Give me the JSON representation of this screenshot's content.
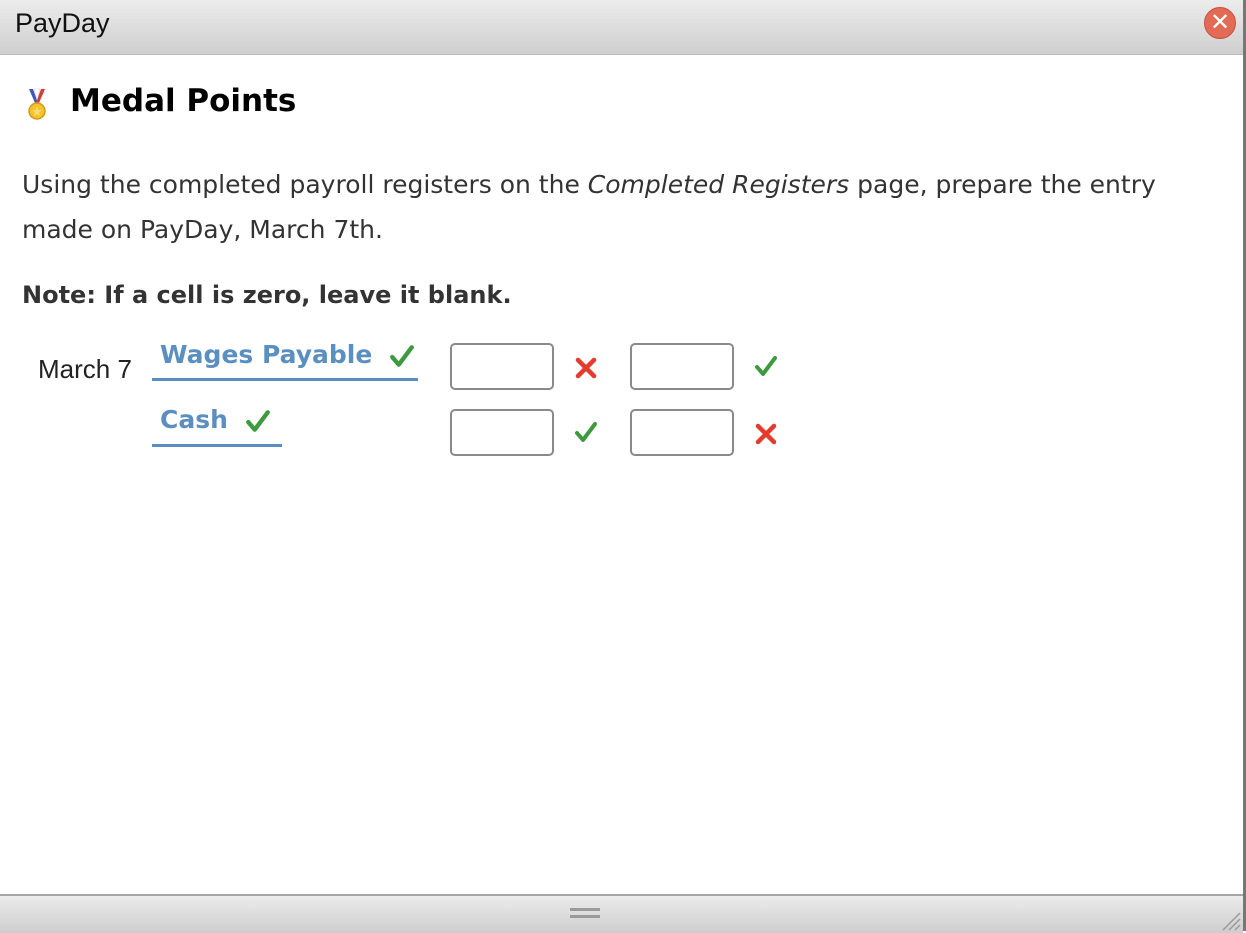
{
  "window": {
    "title": "PayDay",
    "close_icon": "close-x-icon"
  },
  "content": {
    "heading_icon": "medal-icon",
    "heading": "Medal Points",
    "instructions_before": "Using the completed payroll registers on the ",
    "instructions_italic": "Completed Registers",
    "instructions_after": " page, prepare the entry made on PayDay, March 7th.",
    "note": "Note: If a cell is zero, leave it blank."
  },
  "journal_entry": {
    "date": "March 7",
    "rows": [
      {
        "account": "Wages Payable",
        "account_status": "correct",
        "debit_value": "",
        "debit_status": "incorrect",
        "credit_value": "",
        "credit_status": "correct"
      },
      {
        "account": "Cash",
        "account_status": "correct",
        "debit_value": "",
        "debit_status": "correct",
        "credit_value": "",
        "credit_status": "incorrect"
      }
    ]
  },
  "colors": {
    "account_link": "#5b8fc1",
    "correct": "#3f9a3f",
    "incorrect": "#e53b2e",
    "close_button": "#e36a55"
  }
}
